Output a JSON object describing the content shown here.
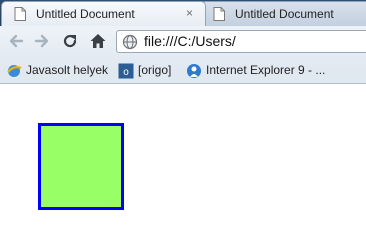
{
  "tabs": [
    {
      "title": "Untitled Document",
      "active": true,
      "close_glyph": "×"
    },
    {
      "title": "Untitled Document",
      "active": false
    }
  ],
  "toolbar": {
    "back_icon": "back-arrow-icon",
    "forward_icon": "forward-arrow-icon",
    "reload_icon": "reload-icon",
    "home_icon": "home-icon",
    "address": "file:///C:/Users/"
  },
  "bookmarks": [
    {
      "label": "Javasolt helyek",
      "icon": "suggested-sites-icon"
    },
    {
      "label": "[origo]",
      "icon": "origo-icon"
    },
    {
      "label": "Internet Explorer 9 - ...",
      "icon": "ie9-icon"
    }
  ],
  "content": {
    "square_fill": "#99ff66",
    "square_border": "#0000ff"
  }
}
